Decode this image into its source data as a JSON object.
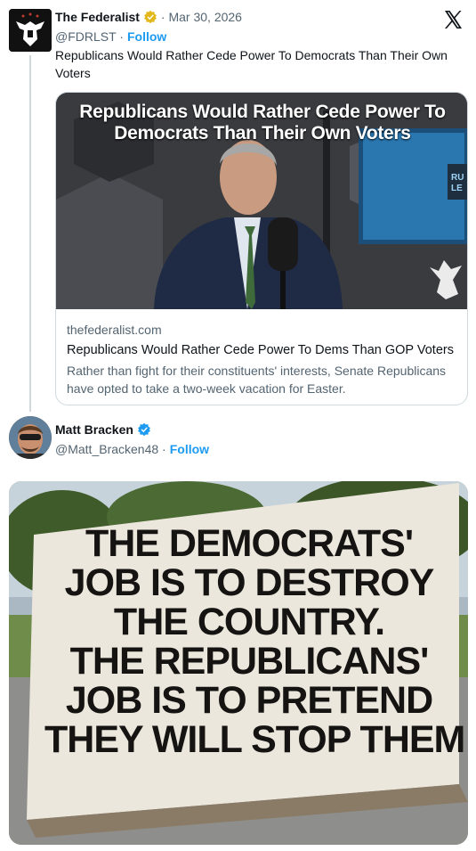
{
  "tweet1": {
    "name": "The Federalist",
    "date": "· Mar 30, 2026",
    "handle": "@FDRLST ·",
    "follow": "Follow",
    "text": "Republicans Would Rather Cede Power To Democrats Than Their Own Voters",
    "card": {
      "image_title_line1": "Republicans Would Rather Cede Power To",
      "image_title_line2": "Democrats Than Their Own Voters",
      "screen_text": "RU\nLE",
      "domain": "thefederalist.com",
      "title": "Republicans Would Rather Cede Power To Dems Than GOP Voters",
      "description": "Rather than fight for their constituents' interests, Senate Republicans have opted to take a two-week vacation for Easter."
    }
  },
  "tweet2": {
    "name": "Matt Bracken",
    "handle": "@Matt_Bracken48 ·",
    "follow": "Follow",
    "sign_lines": [
      "THE DEMOCRATS'",
      "JOB IS TO DESTROY",
      "THE COUNTRY.",
      "THE REPUBLICANS'",
      "JOB IS TO PRETEND",
      "THEY WILL STOP THEM"
    ]
  },
  "colors": {
    "accent": "#1d9bf0",
    "gold_badge": "#e2b719",
    "muted_text": "#536471",
    "border": "#cfd9de"
  },
  "icons": [
    "federalist-eagle-logo",
    "gold-verified-badge",
    "x-logo",
    "blue-verified-badge"
  ]
}
